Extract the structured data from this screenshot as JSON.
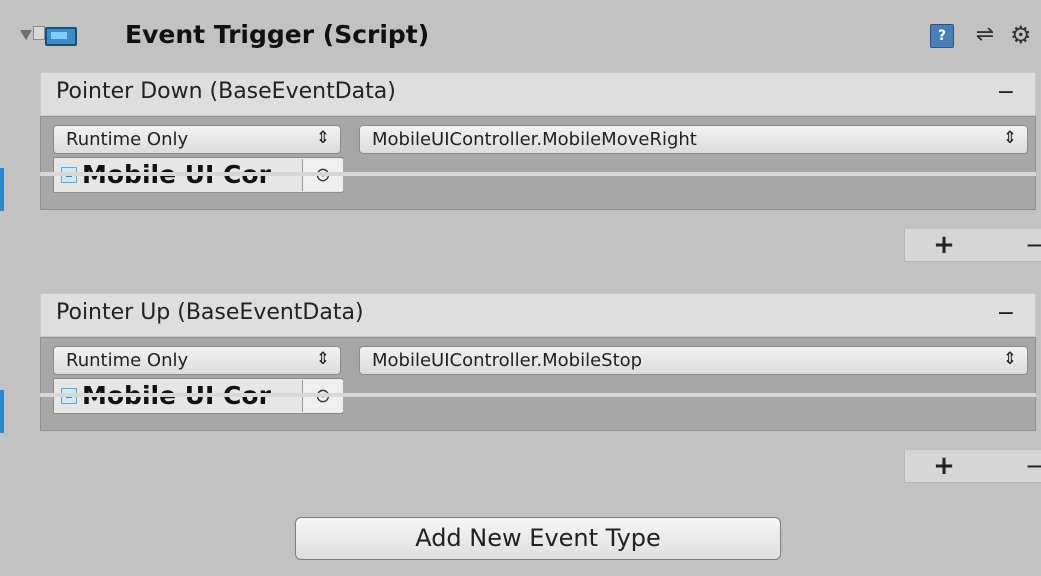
{
  "header": {
    "title": "Event Trigger (Script)",
    "help_icon": "help-icon",
    "presets_icon": "presets-icon",
    "gear_icon": "gear-icon",
    "script_icon": "script-icon"
  },
  "events": [
    {
      "title": "Pointer Down (BaseEventData)",
      "runtime": "Runtime Only",
      "method": "MobileUIController.MobileMoveRight",
      "object": "Mobile UI Cor",
      "remove_label": "−",
      "add_label": "+",
      "footer_remove_label": "−"
    },
    {
      "title": "Pointer Up (BaseEventData)",
      "runtime": "Runtime Only",
      "method": "MobileUIController.MobileStop",
      "object": "Mobile UI Cor",
      "remove_label": "−",
      "add_label": "+",
      "footer_remove_label": "−"
    }
  ],
  "add_event_button": "Add New Event Type",
  "colors": {
    "background": "#c2c2c2",
    "accent": "#2f86d4"
  }
}
